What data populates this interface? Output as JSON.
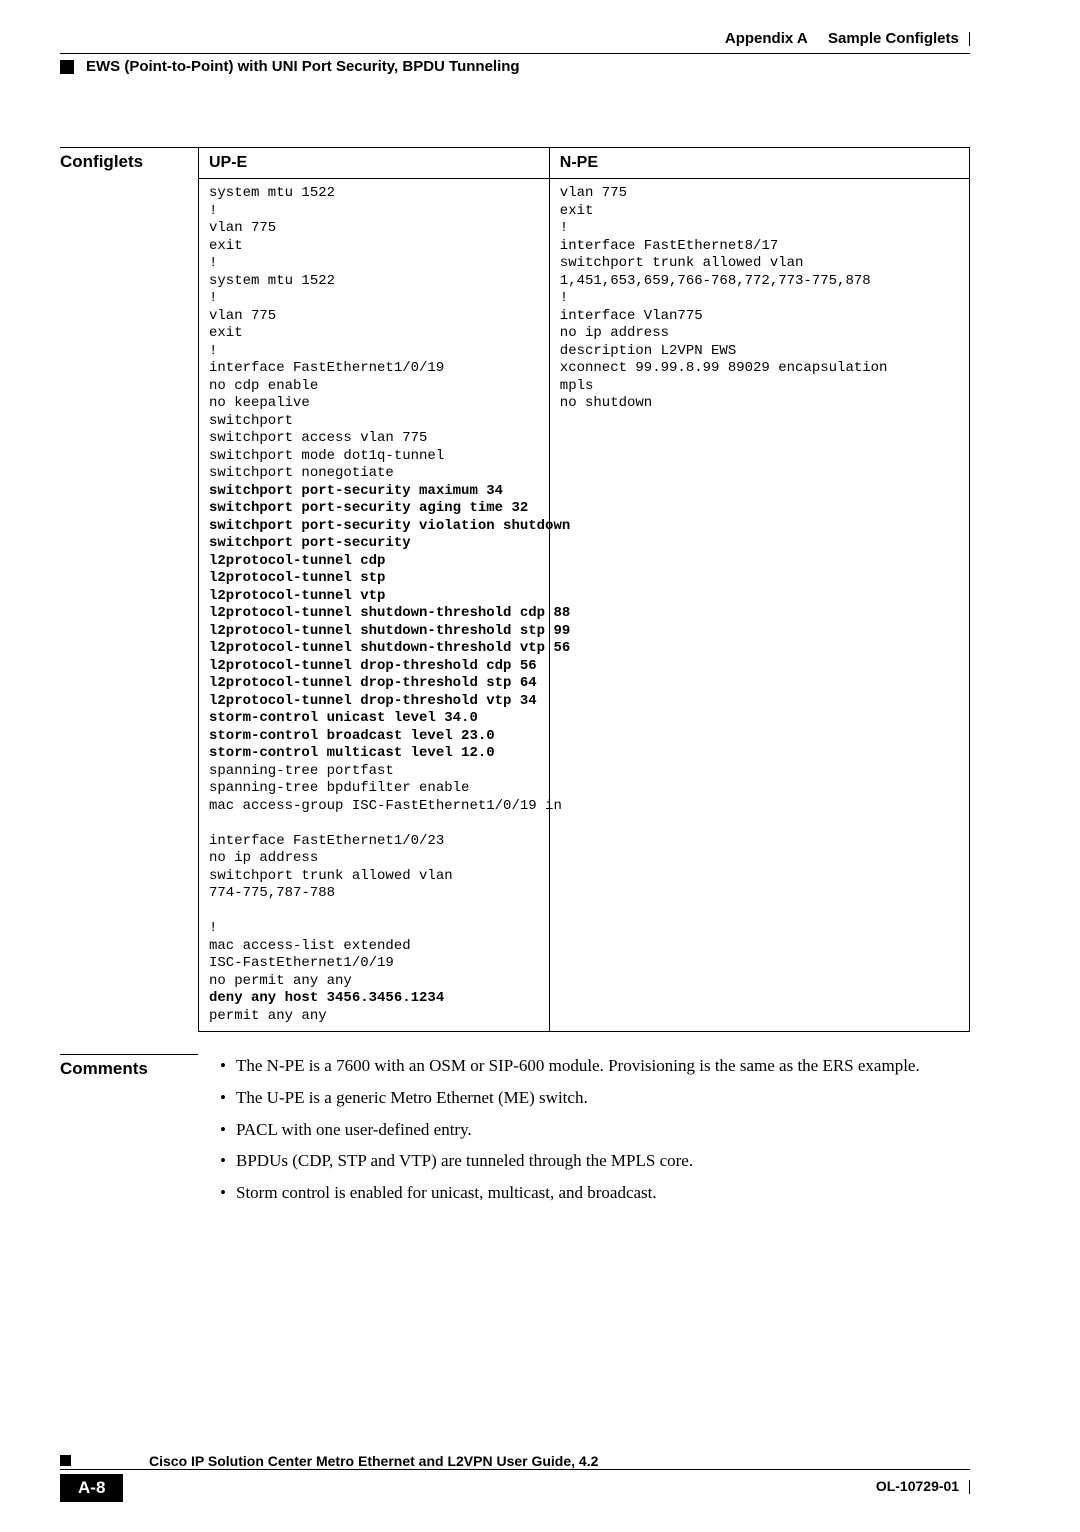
{
  "header": {
    "appendix": "Appendix A",
    "chapter": "Sample Configlets",
    "title": "EWS (Point-to-Point) with UNI Port Security, BPDU Tunneling"
  },
  "configlets": {
    "label": "Configlets",
    "col1_header": "UP-E",
    "col2_header": "N-PE",
    "upe": [
      {
        "t": "system mtu 1522",
        "b": false
      },
      {
        "t": "!",
        "b": false
      },
      {
        "t": "vlan 775",
        "b": false
      },
      {
        "t": "exit",
        "b": false
      },
      {
        "t": "!",
        "b": false
      },
      {
        "t": "system mtu 1522",
        "b": false
      },
      {
        "t": "!",
        "b": false
      },
      {
        "t": "vlan 775",
        "b": false
      },
      {
        "t": "exit",
        "b": false
      },
      {
        "t": "!",
        "b": false
      },
      {
        "t": "interface FastEthernet1/0/19",
        "b": false
      },
      {
        "t": "no cdp enable",
        "b": false
      },
      {
        "t": "no keepalive",
        "b": false
      },
      {
        "t": "switchport",
        "b": false
      },
      {
        "t": "switchport access vlan 775",
        "b": false
      },
      {
        "t": "switchport mode dot1q-tunnel",
        "b": false
      },
      {
        "t": "switchport nonegotiate",
        "b": false
      },
      {
        "t": "switchport port-security maximum 34",
        "b": true
      },
      {
        "t": "switchport port-security aging time 32",
        "b": true
      },
      {
        "t": "switchport port-security violation shutdown",
        "b": true
      },
      {
        "t": "switchport port-security",
        "b": true
      },
      {
        "t": "l2protocol-tunnel cdp",
        "b": true
      },
      {
        "t": "l2protocol-tunnel stp",
        "b": true
      },
      {
        "t": "l2protocol-tunnel vtp",
        "b": true
      },
      {
        "t": "l2protocol-tunnel shutdown-threshold cdp 88",
        "b": true
      },
      {
        "t": "l2protocol-tunnel shutdown-threshold stp 99",
        "b": true
      },
      {
        "t": "l2protocol-tunnel shutdown-threshold vtp 56",
        "b": true
      },
      {
        "t": "l2protocol-tunnel drop-threshold cdp 56",
        "b": true
      },
      {
        "t": "l2protocol-tunnel drop-threshold stp 64",
        "b": true
      },
      {
        "t": "l2protocol-tunnel drop-threshold vtp 34",
        "b": true
      },
      {
        "t": "storm-control unicast level 34.0",
        "b": true
      },
      {
        "t": "storm-control broadcast level 23.0",
        "b": true
      },
      {
        "t": "storm-control multicast level 12.0",
        "b": true
      },
      {
        "t": "spanning-tree portfast",
        "b": false
      },
      {
        "t": "spanning-tree bpdufilter enable",
        "b": false
      },
      {
        "t": "mac access-group ISC-FastEthernet1/0/19 in",
        "b": false
      },
      {
        "t": "",
        "b": false
      },
      {
        "t": "interface FastEthernet1/0/23",
        "b": false
      },
      {
        "t": "no ip address",
        "b": false
      },
      {
        "t": "switchport trunk allowed vlan",
        "b": false
      },
      {
        "t": "774-775,787-788",
        "b": false
      },
      {
        "t": "",
        "b": false
      },
      {
        "t": "!",
        "b": false
      },
      {
        "t": "mac access-list extended",
        "b": false
      },
      {
        "t": "ISC-FastEthernet1/0/19",
        "b": false
      },
      {
        "t": "no permit any any",
        "b": false
      },
      {
        "t": "deny any host 3456.3456.1234",
        "b": true
      },
      {
        "t": "permit any any",
        "b": false
      }
    ],
    "npe": [
      {
        "t": "vlan 775",
        "b": false
      },
      {
        "t": "exit",
        "b": false
      },
      {
        "t": "!",
        "b": false
      },
      {
        "t": "interface FastEthernet8/17",
        "b": false
      },
      {
        "t": "switchport trunk allowed vlan",
        "b": false
      },
      {
        "t": "1,451,653,659,766-768,772,773-775,878",
        "b": false
      },
      {
        "t": "!",
        "b": false
      },
      {
        "t": "interface Vlan775",
        "b": false
      },
      {
        "t": "no ip address",
        "b": false
      },
      {
        "t": "description L2VPN EWS",
        "b": false
      },
      {
        "t": "xconnect 99.99.8.99 89029 encapsulation",
        "b": false
      },
      {
        "t": "mpls",
        "b": false
      },
      {
        "t": "no shutdown",
        "b": false
      }
    ]
  },
  "comments": {
    "label": "Comments",
    "items": [
      "The N-PE is a 7600 with an OSM or SIP-600 module. Provisioning is the same as the ERS example.",
      "The U-PE is a generic Metro Ethernet (ME) switch.",
      "PACL with one user-defined entry.",
      "BPDUs (CDP, STP and VTP) are tunneled through the MPLS core.",
      "Storm control is enabled for unicast, multicast, and broadcast."
    ]
  },
  "footer": {
    "doc_title": "Cisco IP Solution Center Metro Ethernet and L2VPN User Guide, 4.2",
    "page_num": "A-8",
    "doc_id": "OL-10729-01"
  }
}
